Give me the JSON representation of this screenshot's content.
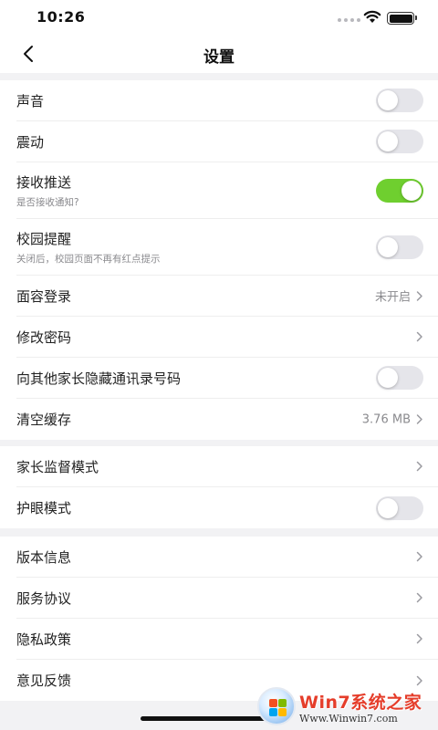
{
  "status_bar": {
    "time": "10:26"
  },
  "nav": {
    "title": "设置"
  },
  "groups": [
    {
      "items": [
        {
          "label": "声音",
          "control": "toggle",
          "on": false
        },
        {
          "label": "震动",
          "control": "toggle",
          "on": false
        },
        {
          "label": "接收推送",
          "sublabel": "是否接收通知?",
          "control": "toggle",
          "on": true
        },
        {
          "label": "校园提醒",
          "sublabel": "关闭后，校园页面不再有红点提示",
          "control": "toggle",
          "on": false
        },
        {
          "label": "面容登录",
          "value": "未开启",
          "control": "chevron"
        },
        {
          "label": "修改密码",
          "control": "chevron"
        },
        {
          "label": "向其他家长隐藏通讯录号码",
          "control": "toggle",
          "on": false
        },
        {
          "label": "清空缓存",
          "value": "3.76 MB",
          "control": "chevron"
        }
      ]
    },
    {
      "items": [
        {
          "label": "家长监督模式",
          "control": "chevron"
        },
        {
          "label": "护眼模式",
          "control": "toggle",
          "on": false
        }
      ]
    },
    {
      "items": [
        {
          "label": "版本信息",
          "control": "chevron"
        },
        {
          "label": "服务协议",
          "control": "chevron"
        },
        {
          "label": "隐私政策",
          "control": "chevron"
        },
        {
          "label": "意见反馈",
          "control": "chevron"
        }
      ]
    }
  ],
  "watermark": {
    "brand": "Win7系统之家",
    "url": "Www.Winwin7.com"
  },
  "colors": {
    "toggle_on": "#6fcf2f",
    "toggle_off": "#e5e5ea",
    "background": "#f2f2f4"
  },
  "icons": {
    "back": "chevron-left-icon",
    "row_arrow": "chevron-right-icon",
    "wifi": "wifi-icon",
    "battery": "battery-icon",
    "signal": "signal-icon"
  }
}
